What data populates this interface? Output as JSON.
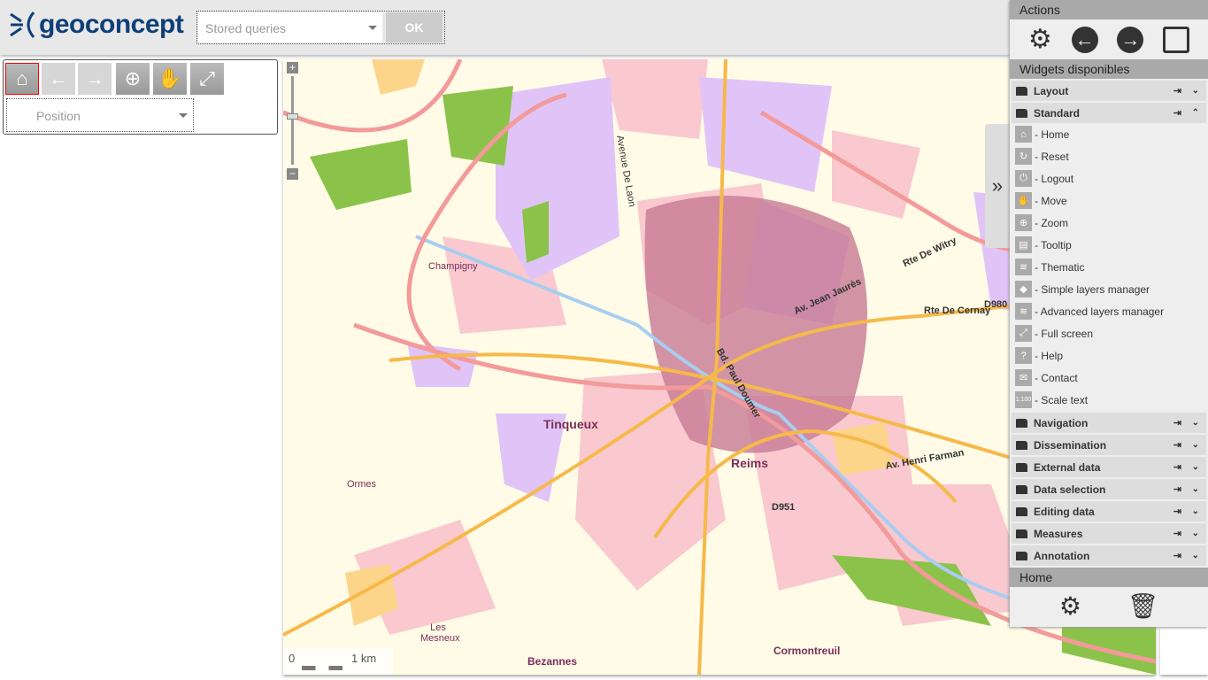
{
  "header": {
    "logo_text": "geoconcept",
    "stored_queries_placeholder": "Stored queries",
    "ok_label": "OK"
  },
  "toolbar": {
    "position_placeholder": "Position"
  },
  "map": {
    "labels": {
      "tinqueux": "Tinqueux",
      "reims": "Reims",
      "champigny": "Champigny",
      "ormes": "Ormes",
      "les_mesneux": "Les Mesneux",
      "bezannes": "Bezannes",
      "cormontreuil": "Cormontreuil",
      "d980": "D980",
      "d951": "D951",
      "av_laon": "Avenue De Laon",
      "rte_cernay": "Rte De Cernay",
      "rte_witry": "Rte De Witry",
      "av_henri_farman": "Av. Henri Farman",
      "av_jean_jaures": "Av. Jean Jaurès",
      "bd_paul_doumer": "Bd. Paul Doumer"
    },
    "scale": {
      "zero": "0",
      "label": "1 km"
    },
    "colors": {
      "background": "#fffbe6",
      "urban": "#f9c9cf",
      "dense": "#c77a93",
      "industrial": "#e0c4f7",
      "forest": "#8bc34a",
      "roads": "#f6b94a",
      "motorway": "#f39a9a",
      "water": "#a8cdf0"
    }
  },
  "panel": {
    "actions_title": "Actions",
    "actions": [
      "settings-icon",
      "back-icon",
      "forward-icon",
      "save-icon"
    ],
    "widgets_title": "Widgets disponibles",
    "groups_top": [
      {
        "label": "Layout",
        "expanded": false
      },
      {
        "label": "Standard",
        "expanded": true
      }
    ],
    "standard_items": [
      {
        "label": "- Home",
        "icon": "home-icon",
        "glyph": "⌂"
      },
      {
        "label": "- Reset",
        "icon": "reset-icon",
        "glyph": "↻"
      },
      {
        "label": "- Logout",
        "icon": "power-icon",
        "glyph": "⏻"
      },
      {
        "label": "- Move",
        "icon": "hand-icon",
        "glyph": "✋"
      },
      {
        "label": "- Zoom",
        "icon": "zoom-icon",
        "glyph": "⊕"
      },
      {
        "label": "- Tooltip",
        "icon": "tooltip-icon",
        "glyph": "▤"
      },
      {
        "label": "- Thematic",
        "icon": "thematic-icon",
        "glyph": "≋"
      },
      {
        "label": "- Simple layers manager",
        "icon": "layer-icon",
        "glyph": "◆"
      },
      {
        "label": "- Advanced layers manager",
        "icon": "layers-icon",
        "glyph": "≋"
      },
      {
        "label": "- Full screen",
        "icon": "fullscreen-icon",
        "glyph": "⤢"
      },
      {
        "label": "- Help",
        "icon": "help-icon",
        "glyph": "?"
      },
      {
        "label": "- Contact",
        "icon": "mail-icon",
        "glyph": "✉"
      },
      {
        "label": "- Scale text",
        "icon": "scale-text-icon",
        "glyph": "1:100"
      }
    ],
    "groups_bottom": [
      "Navigation",
      "Dissemination",
      "External data",
      "Data selection",
      "Editing data",
      "Measures",
      "Annotation"
    ],
    "home_title": "Home",
    "home_actions": [
      "settings-icon",
      "trash-icon"
    ]
  }
}
